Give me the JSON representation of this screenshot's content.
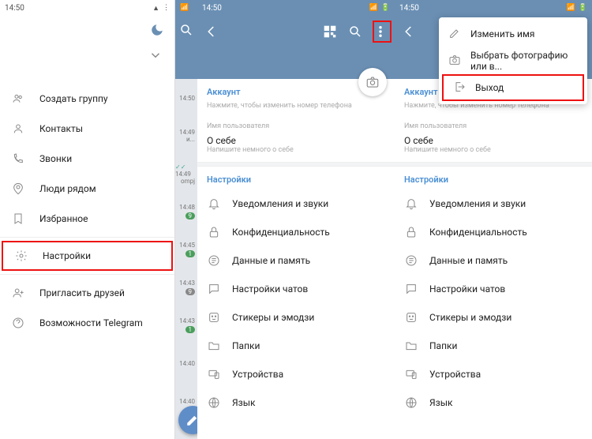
{
  "status": {
    "time": "14:50",
    "battery": "55"
  },
  "drawer": {
    "items": [
      {
        "icon": "group",
        "label": "Создать группу"
      },
      {
        "icon": "user",
        "label": "Контакты"
      },
      {
        "icon": "phone",
        "label": "Звонки"
      },
      {
        "icon": "people",
        "label": "Люди рядом"
      },
      {
        "icon": "bookmark",
        "label": "Избранное"
      },
      {
        "icon": "gear",
        "label": "Настройки"
      },
      {
        "icon": "adduser",
        "label": "Пригласить друзей"
      },
      {
        "icon": "help",
        "label": "Возможности Telegram"
      }
    ]
  },
  "chatbg": {
    "items": [
      {
        "time": "14:50",
        "badge": ""
      },
      {
        "time": "14:49",
        "badge": "",
        "text": "и..."
      },
      {
        "time": "14:49",
        "badge": "",
        "text": "ompj",
        "tick": true
      },
      {
        "time": "14:48",
        "badge": "9",
        "green": true
      },
      {
        "time": "14:45",
        "badge": "1",
        "green": true
      },
      {
        "time": "14:43",
        "badge": "9"
      },
      {
        "time": "14:43",
        "badge": "1",
        "green": true
      },
      {
        "time": "14:40",
        "badge": ""
      },
      {
        "time": "14:40",
        "badge": ""
      }
    ]
  },
  "settings": {
    "account_title": "Аккаунт",
    "phone_hint": "Нажмите, чтобы изменить номер телефона",
    "username_label": "Имя пользователя",
    "about_label": "О себе",
    "about_hint": "Напишите немного о себе",
    "section_title": "Настройки",
    "items": [
      {
        "icon": "bell",
        "label": "Уведомления и звуки"
      },
      {
        "icon": "lock",
        "label": "Конфиденциальность"
      },
      {
        "icon": "data",
        "label": "Данные и память"
      },
      {
        "icon": "chat",
        "label": "Настройки чатов"
      },
      {
        "icon": "sticker",
        "label": "Стикеры и эмодзи"
      },
      {
        "icon": "folder",
        "label": "Папки"
      },
      {
        "icon": "device",
        "label": "Устройства"
      },
      {
        "icon": "globe",
        "label": "Язык"
      }
    ]
  },
  "popup": {
    "items": [
      {
        "icon": "edit",
        "label": "Изменить имя"
      },
      {
        "icon": "camera",
        "label": "Выбрать фотографию или в..."
      },
      {
        "icon": "logout",
        "label": "Выход"
      }
    ]
  }
}
